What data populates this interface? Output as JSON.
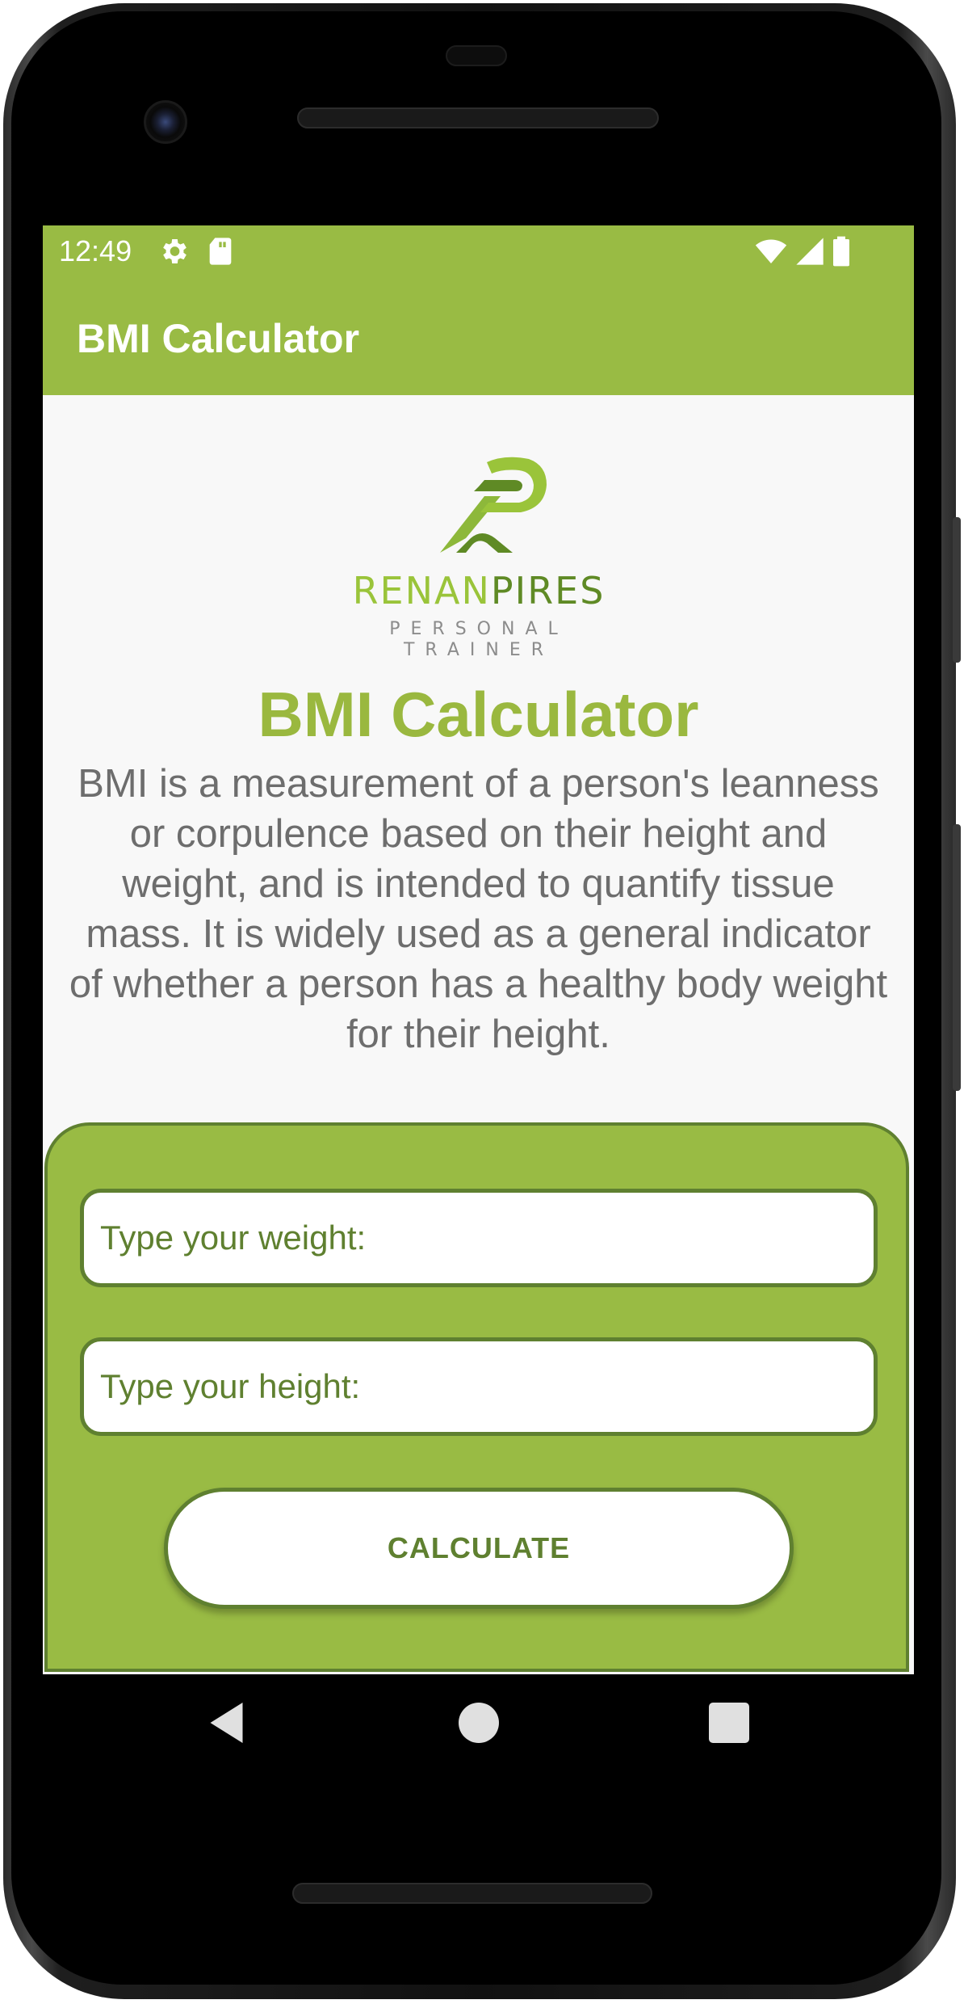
{
  "status_bar": {
    "time": "12:49",
    "left_icons": [
      "settings-icon",
      "sd-card-icon"
    ],
    "right_icons": [
      "wifi-icon",
      "signal-icon",
      "battery-icon"
    ]
  },
  "app_bar": {
    "title": "BMI Calculator"
  },
  "logo": {
    "name_part1": "RENAN",
    "name_part2": "PIRES",
    "tagline": "PERSONAL TRAINER"
  },
  "main": {
    "title": "BMI Calculator",
    "description": "BMI is a measurement of a person's leanness or corpulence based on their height and weight, and is intended to quantify tissue mass. It is widely used as a general indicator of whether a person has a healthy body weight for their height."
  },
  "form": {
    "weight_placeholder": "Type your weight:",
    "weight_value": "",
    "height_placeholder": "Type your height:",
    "height_value": "",
    "calculate_label": "CALCULATE"
  },
  "nav_bar": {
    "buttons": [
      "back-icon",
      "home-icon",
      "recents-icon"
    ]
  },
  "colors": {
    "primary": "#99bb44",
    "primary_dark": "#5f8030",
    "title_green": "#9ab83f",
    "background": "#f8f8f8",
    "text_gray": "#6d6d6d"
  }
}
